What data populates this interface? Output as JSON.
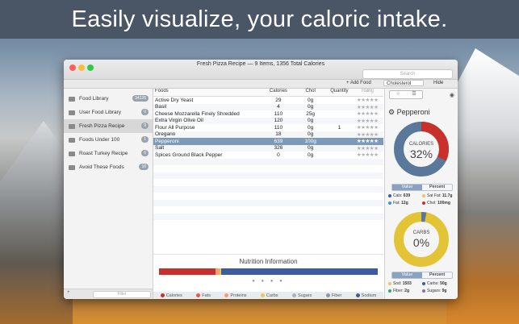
{
  "banner": {
    "text": "Easily visualize, your caloric intake."
  },
  "window": {
    "title": "Fresh Pizza Recipe — 9 Items, 1356 Total Calories"
  },
  "search": {
    "placeholder": "Search"
  },
  "toolbar": {
    "add_food": "+ Add Food",
    "nutrient_select": "Cholesterol",
    "hide": "Hide"
  },
  "sidebar": {
    "items": [
      {
        "label": "Food Library",
        "count": "34126"
      },
      {
        "label": "User Food Library",
        "count": "0"
      },
      {
        "label": "Fresh Pizza Recipe",
        "count": "9"
      },
      {
        "label": "Foods Under 100",
        "count": "1"
      },
      {
        "label": "Roast Turkey Recipe",
        "count": "6"
      },
      {
        "label": "Avoid These Foods",
        "count": "16"
      }
    ],
    "bottom": {
      "add": "+",
      "filter": "Filter"
    }
  },
  "table": {
    "headers": {
      "food": "Foods",
      "calories": "Calories",
      "chol": "Chol",
      "quantity": "Quantity",
      "rating": "Rating"
    },
    "rows": [
      {
        "food": "Active Dry Yeast",
        "calories": "29",
        "chol": "0g",
        "qty": "",
        "rating": "★★★★★"
      },
      {
        "food": "Basil",
        "calories": "4",
        "chol": "0g",
        "qty": "",
        "rating": "★★★★★"
      },
      {
        "food": "Cheese Mozzarella Finely Shredded",
        "calories": "110",
        "chol": "25g",
        "qty": "",
        "rating": "★★★★★"
      },
      {
        "food": "Extra Virgin Olive Oil",
        "calories": "120",
        "chol": "0g",
        "qty": "",
        "rating": "★★★★★"
      },
      {
        "food": "Flour All Purpose",
        "calories": "110",
        "chol": "0g",
        "qty": "1",
        "rating": "★★★★★"
      },
      {
        "food": "Oregano",
        "calories": "18",
        "chol": "0g",
        "qty": "",
        "rating": "★★★★★"
      },
      {
        "food": "Pepperoni",
        "calories": "639",
        "chol": "100g",
        "qty": "",
        "rating": "★★★★★"
      },
      {
        "food": "Salt",
        "calories": "326",
        "chol": "0g",
        "qty": "",
        "rating": "★★★★★"
      },
      {
        "food": "Spices Ground Black Pepper",
        "calories": "0",
        "chol": "0g",
        "qty": "",
        "rating": "★★★★★"
      }
    ]
  },
  "nutrition": {
    "title": "Nutrition Information",
    "bar": [
      {
        "name": "Calories",
        "value": 26,
        "color": "#c9302c"
      },
      {
        "name": "Fats",
        "value": 1.5,
        "color": "#f0a070"
      },
      {
        "name": "Sugars",
        "value": 1,
        "color": "#e8c85a"
      },
      {
        "name": "Sodium",
        "value": 71.5,
        "color": "#3b5da0"
      }
    ],
    "legend": [
      {
        "label": "Calories",
        "color": "#c9302c"
      },
      {
        "label": "Fats",
        "color": "#e05a50"
      },
      {
        "label": "Proteins",
        "color": "#f0a070"
      },
      {
        "label": "Carbs",
        "color": "#e8c85a"
      },
      {
        "label": "Sugars",
        "color": "#aab4bf"
      },
      {
        "label": "Fiber",
        "color": "#8899aa"
      },
      {
        "label": "Sodium",
        "color": "#3b5da0"
      }
    ]
  },
  "detail": {
    "title": "Pepperoni",
    "calories_chart": {
      "label": "CALORIES",
      "percent": "32%",
      "fraction": 0.32
    },
    "carbs_chart": {
      "label": "CARBS",
      "percent": "0%",
      "fraction": 0.0
    },
    "toggle": {
      "value": "Value",
      "percent": "Percent"
    },
    "stats1": [
      {
        "label": "Cals:",
        "value": "639",
        "color": "#3b5da0"
      },
      {
        "label": "Sat Fat:",
        "value": "11.7g",
        "color": "#e8c85a"
      },
      {
        "label": "Fat:",
        "value": "12g",
        "color": "#4a90c9"
      },
      {
        "label": "Chol:",
        "value": "100mg",
        "color": "#c9302c"
      }
    ],
    "stats2": [
      {
        "label": "Sod:",
        "value": "1503",
        "color": "#e8c85a"
      },
      {
        "label": "Carbs:",
        "value": "50g",
        "color": "#3b5da0"
      },
      {
        "label": "Fiber:",
        "value": "2g",
        "color": "#2aa876"
      },
      {
        "label": "Sugars:",
        "value": "9g",
        "color": "#8a6cb5"
      }
    ]
  }
}
